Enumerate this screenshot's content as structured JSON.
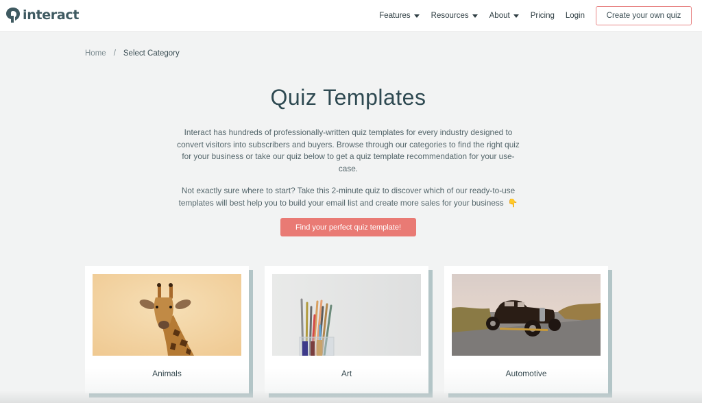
{
  "header": {
    "logo_text": "interact",
    "logo_icon": "interact-logo-icon",
    "nav": [
      {
        "label": "Features",
        "has_dropdown": true
      },
      {
        "label": "Resources",
        "has_dropdown": true
      },
      {
        "label": "About",
        "has_dropdown": true
      },
      {
        "label": "Pricing",
        "has_dropdown": false
      },
      {
        "label": "Login",
        "has_dropdown": false
      }
    ],
    "cta_label": "Create your own quiz"
  },
  "breadcrumb": {
    "home": "Home",
    "separator": "/",
    "current": "Select Category"
  },
  "main": {
    "title": "Quiz Templates",
    "intro": "Interact has hundreds of professionally-written quiz templates for every industry designed to convert visitors into subscribers and buyers. Browse through our categories to find the right quiz for your business or take our quiz below to get a quiz template recommendation for your use-case.",
    "prompt": "Not exactly sure where to start? Take this 2-minute quiz to discover which of our ready-to-use templates will best help you to build your email list and create more sales for your business",
    "prompt_emoji": "👇",
    "find_button_label": "Find your perfect quiz template!"
  },
  "categories": [
    {
      "label": "Animals",
      "image": "giraffe-photo"
    },
    {
      "label": "Art",
      "image": "paintbrushes-jar-photo"
    },
    {
      "label": "Automotive",
      "image": "vintage-car-photo"
    }
  ],
  "colors": {
    "accent": "#e97a74",
    "cta_border": "#e88585",
    "text_dark": "#2f4a52",
    "page_bg": "#f2f3f3",
    "card_shadow": "#b3c5c7"
  }
}
